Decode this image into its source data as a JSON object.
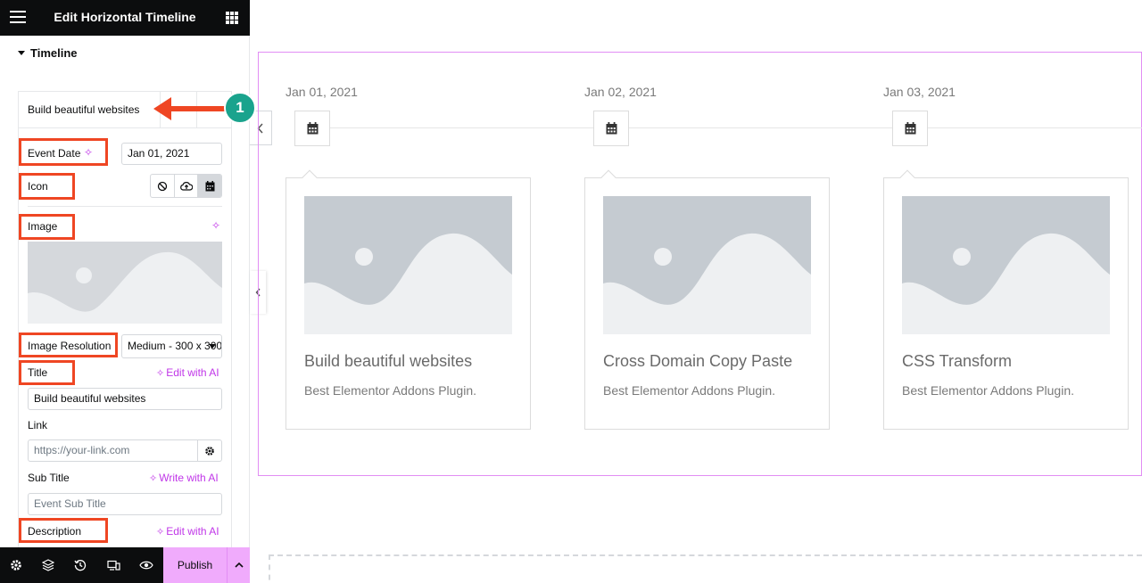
{
  "topbar": {
    "title": "Edit Horizontal Timeline"
  },
  "panel": {
    "section": "Timeline",
    "repeater_item_label": "Build beautiful websites",
    "fields": {
      "event_date": {
        "label": "Event Date",
        "value": "Jan 01, 2021"
      },
      "icon": {
        "label": "Icon",
        "options": [
          "none-icon",
          "upload-icon",
          "calendar-icon"
        ],
        "selected": "calendar-icon"
      },
      "image": {
        "label": "Image"
      },
      "image_resolution": {
        "label": "Image Resolution",
        "value": "Medium - 300 x 300"
      },
      "title": {
        "label": "Title",
        "ai_action": "Edit with AI",
        "value": "Build beautiful websites"
      },
      "link": {
        "label": "Link",
        "placeholder": "https://your-link.com"
      },
      "sub_title": {
        "label": "Sub Title",
        "ai_action": "Write with AI",
        "placeholder": "Event Sub Title"
      },
      "description": {
        "label": "Description",
        "ai_action": "Edit with AI"
      }
    },
    "callout_number": "1"
  },
  "bottombar": {
    "icons": [
      "settings-icon",
      "layers-icon",
      "history-icon",
      "responsive-icon",
      "preview-icon"
    ],
    "publish_label": "Publish"
  },
  "timeline": {
    "items": [
      {
        "date": "Jan 01, 2021",
        "title": "Build beautiful websites",
        "description": "Best Elementor Addons Plugin."
      },
      {
        "date": "Jan 02, 2021",
        "title": "Cross Domain Copy Paste",
        "description": "Best Elementor Addons Plugin."
      },
      {
        "date": "Jan 03, 2021",
        "title": "CSS Transform",
        "description": "Best Elementor Addons Plugin."
      }
    ]
  },
  "colors": {
    "highlight": "#ef4623",
    "ai_accent": "#c036e8",
    "publish_bg": "#f0abfc",
    "callout_badge": "#1aa38d",
    "section_outline": "#e28ef4"
  }
}
